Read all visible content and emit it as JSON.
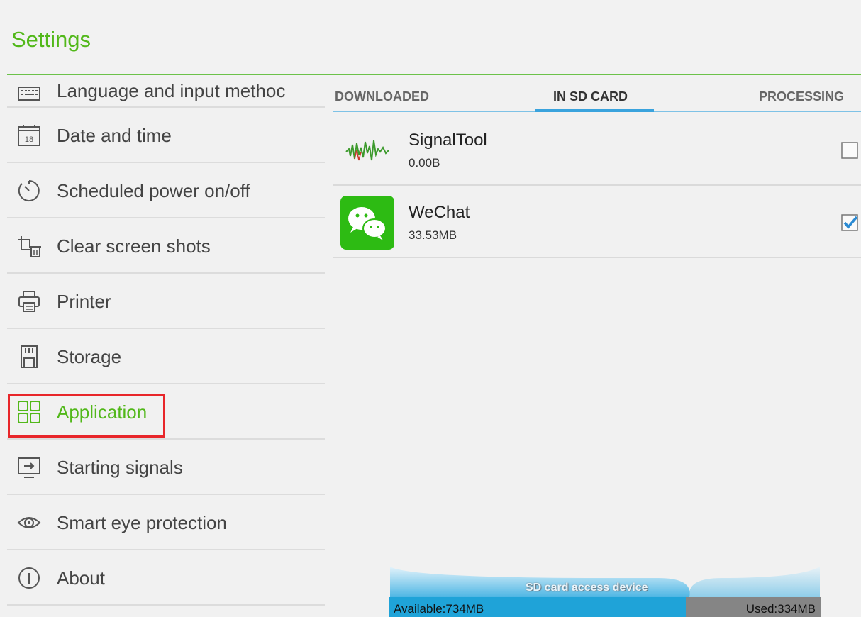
{
  "header": {
    "title": "Settings"
  },
  "sidebar": {
    "items": [
      {
        "label": "Language and input methoc",
        "icon": "keyboard-icon"
      },
      {
        "label": "Date and time",
        "icon": "calendar-icon",
        "icon_text": "18"
      },
      {
        "label": "Scheduled power on/off",
        "icon": "timer-icon"
      },
      {
        "label": "Clear screen shots",
        "icon": "crop-trash-icon"
      },
      {
        "label": "Printer",
        "icon": "printer-icon"
      },
      {
        "label": "Storage",
        "icon": "sd-card-icon"
      },
      {
        "label": "Application",
        "icon": "apps-grid-icon",
        "selected": true
      },
      {
        "label": "Starting signals",
        "icon": "input-signal-icon"
      },
      {
        "label": "Smart eye protection",
        "icon": "eye-icon"
      },
      {
        "label": "About",
        "icon": "info-icon"
      }
    ]
  },
  "tabs": [
    {
      "label": "DOWNLOADED"
    },
    {
      "label": "IN SD CARD",
      "active": true
    },
    {
      "label": "PROCESSING"
    }
  ],
  "apps": [
    {
      "name": "SignalTool",
      "size": "0.00B",
      "checked": false,
      "icon": "signal-waveform-icon"
    },
    {
      "name": "WeChat",
      "size": "33.53MB",
      "checked": true,
      "icon": "wechat-icon"
    }
  ],
  "storage": {
    "caption": "SD card access device",
    "available": "Available:734MB",
    "used": "Used:334MB",
    "available_fraction": 0.687
  },
  "colors": {
    "accent_green": "#52b81a",
    "tab_blue": "#3aa3dd",
    "selection_red": "#e8262a",
    "storage_blue": "#1fa3d8",
    "storage_gray": "#858585"
  }
}
